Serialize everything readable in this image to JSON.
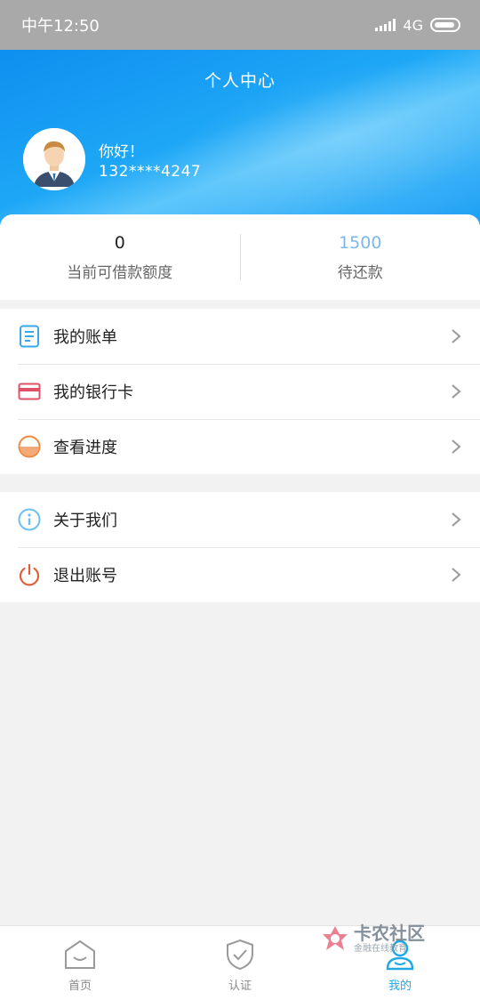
{
  "status_bar": {
    "time": "中午12:50",
    "network": "4G"
  },
  "header": {
    "title": "个人中心",
    "greeting": "你好！",
    "phone": "132****4247"
  },
  "stats": {
    "credit_value": "0",
    "credit_label": "当前可借款额度",
    "repay_value": "1500",
    "repay_label": "待还款"
  },
  "menu_group_1": [
    {
      "label": "我的账单",
      "icon": "bill-icon"
    },
    {
      "label": "我的银行卡",
      "icon": "bank-card-icon"
    },
    {
      "label": "查看进度",
      "icon": "progress-icon"
    }
  ],
  "menu_group_2": [
    {
      "label": "关于我们",
      "icon": "info-icon"
    },
    {
      "label": "退出账号",
      "icon": "power-icon"
    }
  ],
  "bottom_nav": [
    {
      "label": "首页",
      "icon": "home-icon",
      "active": false
    },
    {
      "label": "认证",
      "icon": "shield-check-icon",
      "active": false
    },
    {
      "label": "我的",
      "icon": "user-icon",
      "active": true
    }
  ],
  "watermark": {
    "title": "卡农社区",
    "subtitle": "金融在线教育"
  },
  "colors": {
    "accent": "#20a7e6",
    "header_blue": "#1ea7f6",
    "bill_icon": "#3aa7e8",
    "card_icon": "#e05168",
    "progress_icon": "#f08a40",
    "info_icon": "#6cc1ec",
    "power_icon": "#e0603a"
  }
}
